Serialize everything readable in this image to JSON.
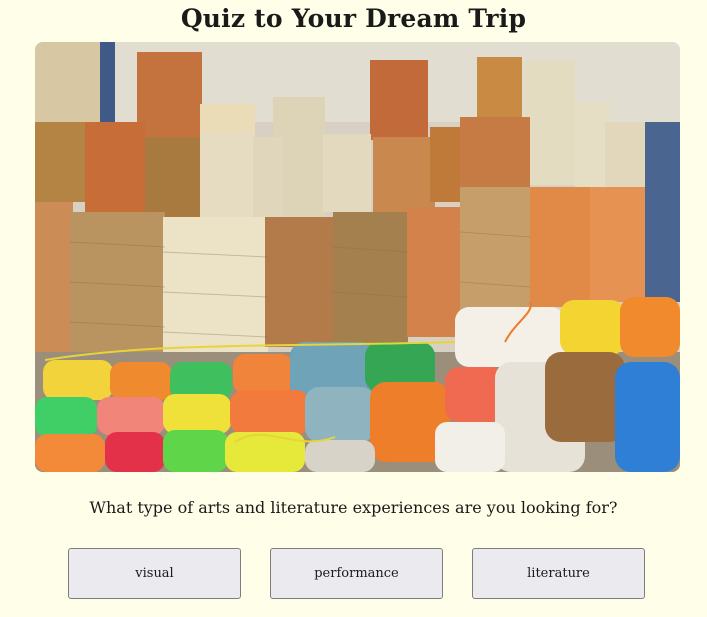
{
  "title": "Quiz to Your Dream Trip",
  "image": {
    "subject": "photo-spools-of-twine-and-rope"
  },
  "question": "What type of arts and literature experiences are you looking for?",
  "options": [
    {
      "label": "visual"
    },
    {
      "label": "performance"
    },
    {
      "label": "literature"
    }
  ],
  "colors": {
    "background": "#fefee9",
    "button_bg": "#ebebef",
    "button_border": "#7d7d7d"
  }
}
